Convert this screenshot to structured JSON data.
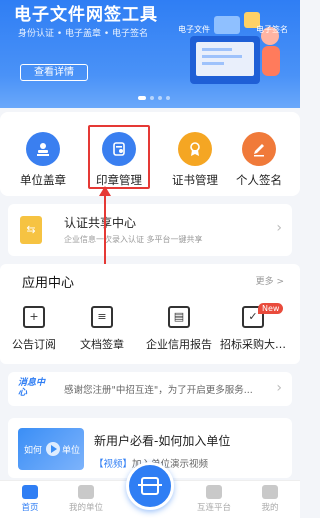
{
  "banner": {
    "title": "电子文件网签工具",
    "subtitle": "身份认证 • 电子盖章 • 电子签名",
    "button": "查看详情",
    "art_label_left": "电子文件",
    "art_label_right": "电子签名"
  },
  "quick_actions": [
    {
      "label": "单位盖章",
      "icon": "stamp-icon",
      "color": "#3a7ff0"
    },
    {
      "label": "印章管理",
      "icon": "seal-manage-icon",
      "color": "#3a7ff0"
    },
    {
      "label": "证书管理",
      "icon": "certificate-icon",
      "color": "#f5a623"
    },
    {
      "label": "个人签名",
      "icon": "pen-icon",
      "color": "#f07a3a"
    }
  ],
  "share_center": {
    "title": "认证共享中心",
    "desc": "企业信息一次录入认证 多平台一键共享"
  },
  "app_center": {
    "title": "应用中心",
    "more": "更多 >",
    "items": [
      {
        "label": "公告订阅",
        "icon": "bookmark-plus-icon"
      },
      {
        "label": "文档签章",
        "icon": "document-stamp-icon"
      },
      {
        "label": "企业信用报告",
        "icon": "credit-report-icon"
      },
      {
        "label": "招标采购大…",
        "icon": "bid-procurement-icon"
      }
    ],
    "new_badge": "New"
  },
  "notice": {
    "tag": "消息中心",
    "text": "感谢您注册\"中招互连\"，为了开启更多服务..."
  },
  "video": {
    "thumb_left": "如何",
    "thumb_right": "单位",
    "title": "新用户必看-如何加入单位",
    "tag": "【视频】",
    "desc": "加入单位演示视频"
  },
  "tabbar": [
    {
      "label": "首页",
      "icon": "home-icon",
      "active": true
    },
    {
      "label": "我的单位",
      "icon": "building-icon",
      "active": false
    },
    {
      "label": "互连平台",
      "icon": "chart-icon",
      "active": false
    },
    {
      "label": "我的",
      "icon": "user-icon",
      "active": false
    }
  ],
  "colors": {
    "accent": "#2f7ef4",
    "highlight": "#e53935"
  }
}
